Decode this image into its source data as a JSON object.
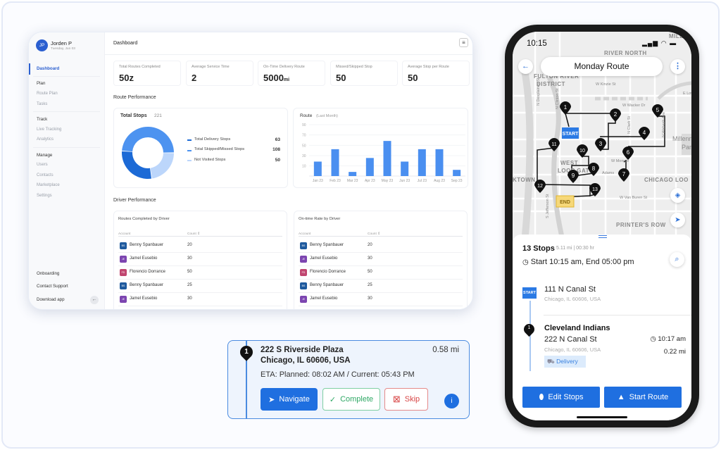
{
  "dashboard": {
    "user": {
      "initials": "JP",
      "name": "Jorden P",
      "date": "Tuesday, Jun 03"
    },
    "header_title": "Dashboard",
    "sidebar": {
      "active": "Dashboard",
      "sections": [
        {
          "title": "Plan",
          "items": [
            "Route Plan",
            "Tasks"
          ]
        },
        {
          "title": "Track",
          "items": [
            "Live Tracking",
            "Analytics"
          ]
        },
        {
          "title": "Manage",
          "items": [
            "Users",
            "Contacts",
            "Marketplace",
            "Settings"
          ]
        }
      ],
      "footer": [
        "Onboarding",
        "Contact Support",
        "Download app"
      ]
    },
    "kpis": [
      {
        "label": "Total Routes Completed",
        "value": "50z",
        "unit": ""
      },
      {
        "label": "Average Service Time",
        "value": "2",
        "unit": ""
      },
      {
        "label": "On-Time Delivery Route",
        "value": "5000",
        "unit": "mi"
      },
      {
        "label": "Missed/Skipped Stop",
        "value": "50",
        "unit": ""
      },
      {
        "label": "Average Stop per Route",
        "value": "50",
        "unit": ""
      }
    ],
    "route_performance_title": "Route Performance",
    "driver_performance_title": "Driver Performance",
    "tables": [
      {
        "title": "Routes Completed by Driver",
        "col_account": "Account",
        "col_count": "Count",
        "rows": [
          {
            "initials": "BS",
            "name": "Benny Spanbauer",
            "count": "20",
            "color": "#1f5a9e"
          },
          {
            "initials": "JE",
            "name": "Jamel Eusebio",
            "count": "30",
            "color": "#7c45b0"
          },
          {
            "initials": "FD",
            "name": "Florencio Dorrance",
            "count": "50",
            "color": "#c0456f"
          },
          {
            "initials": "BS",
            "name": "Benny Spanbauer",
            "count": "25",
            "color": "#1f5a9e"
          },
          {
            "initials": "JE",
            "name": "Jamel Eusebio",
            "count": "30",
            "color": "#7c45b0"
          }
        ]
      },
      {
        "title": "On-time Rate by Driver",
        "col_account": "Account",
        "col_count": "Count",
        "rows": [
          {
            "initials": "BS",
            "name": "Benny Spanbauer",
            "count": "20",
            "color": "#1f5a9e"
          },
          {
            "initials": "JE",
            "name": "Jamel Eusebio",
            "count": "30",
            "color": "#7c45b0"
          },
          {
            "initials": "FD",
            "name": "Florencio Dorrance",
            "count": "50",
            "color": "#c0456f"
          },
          {
            "initials": "BS",
            "name": "Benny Spanbauer",
            "count": "25",
            "color": "#1f5a9e"
          },
          {
            "initials": "JE",
            "name": "Jamel Eusebio",
            "count": "30",
            "color": "#7c45b0"
          }
        ]
      }
    ]
  },
  "chart_data": [
    {
      "type": "pie",
      "title": "Total Stops",
      "total": "221",
      "donut": true,
      "slices": [
        {
          "name": "Total Delivery Stops",
          "value": 63,
          "color": "#1c6ad6"
        },
        {
          "name": "Total Skipped/Missed Stops",
          "value": 108,
          "color": "#4d93f0"
        },
        {
          "name": "Not Visited Stops",
          "value": 50,
          "color": "#bcd6fb"
        }
      ],
      "legend": "right"
    },
    {
      "type": "bar",
      "title": "Route",
      "subtitle": "(Last Month)",
      "categories": [
        "Jan 23",
        "Feb 23",
        "Mar 23",
        "Apr 23",
        "May 23",
        "Jun 23",
        "Jul 23",
        "Aug 23",
        "Sep 23"
      ],
      "values": [
        28,
        52,
        8,
        35,
        68,
        28,
        52,
        52,
        12
      ],
      "yticks": [
        10,
        30,
        50,
        70,
        90
      ],
      "ylim": [
        0,
        90
      ],
      "color": "#4a8ff0",
      "grid": true
    }
  ],
  "stop_card": {
    "number": "1",
    "address1": "222 S Riverside Plaza",
    "address2": "Chicago, IL 60606, USA",
    "distance": "0.58 mi",
    "eta": "ETA: Planned: 08:02 AM / Current: 05:43 PM",
    "navigate": "Navigate",
    "complete": "Complete",
    "skip": "Skip",
    "info": "i"
  },
  "phone": {
    "time": "10:15",
    "route_title": "Monday Route",
    "map_labels": {
      "river_north": "RIVER NORTH",
      "fulton1": "FULTON RIVER",
      "fulton2": "DISTRICT",
      "kinzie": "W Kinzie St",
      "wacker": "W Wacker Dr",
      "west": "WEST",
      "loop_gate": "LOOP GATE",
      "chicago_loop": "CHICAGO LOO",
      "van_buren": "W Van Buren St",
      "printers_row": "PRINTER'S ROW",
      "ktown": "KTOWN",
      "millenn": "Millenn",
      "par": "Par",
      "mile": "MILLE",
      "lowe": "E Lowe",
      "desplaines": "N Desplaines St",
      "clinton": "N Clinton St",
      "jefferson": "S Jefferson St",
      "monroe": "W Monroe",
      "adams": "Adams",
      "clark": "N Clark St",
      "wabash": "N Wabash Ave"
    },
    "markers": [
      "1",
      "2",
      "3",
      "4",
      "5",
      "6",
      "7",
      "8",
      "9",
      "10",
      "11",
      "12",
      "13"
    ],
    "start_label": "START",
    "end_label": "END",
    "stops_count": "13 Stops",
    "stops_meta": "5.11 mi | 00:30 hr",
    "schedule": "Start 10:15 am, End 05:00 pm",
    "start_stop": {
      "badge": "START",
      "address": "111 N Canal St",
      "city": "Chicago, IL 60606, USA"
    },
    "stop1": {
      "number": "1",
      "name": "Cleveland Indians",
      "address": "222 N Canal St",
      "city": "Chicago, IL 60606, USA",
      "time": "10:17 am",
      "distance": "0.22 mi",
      "tag": "Delivery"
    },
    "edit_stops": "Edit Stops",
    "start_route": "Start Route"
  }
}
